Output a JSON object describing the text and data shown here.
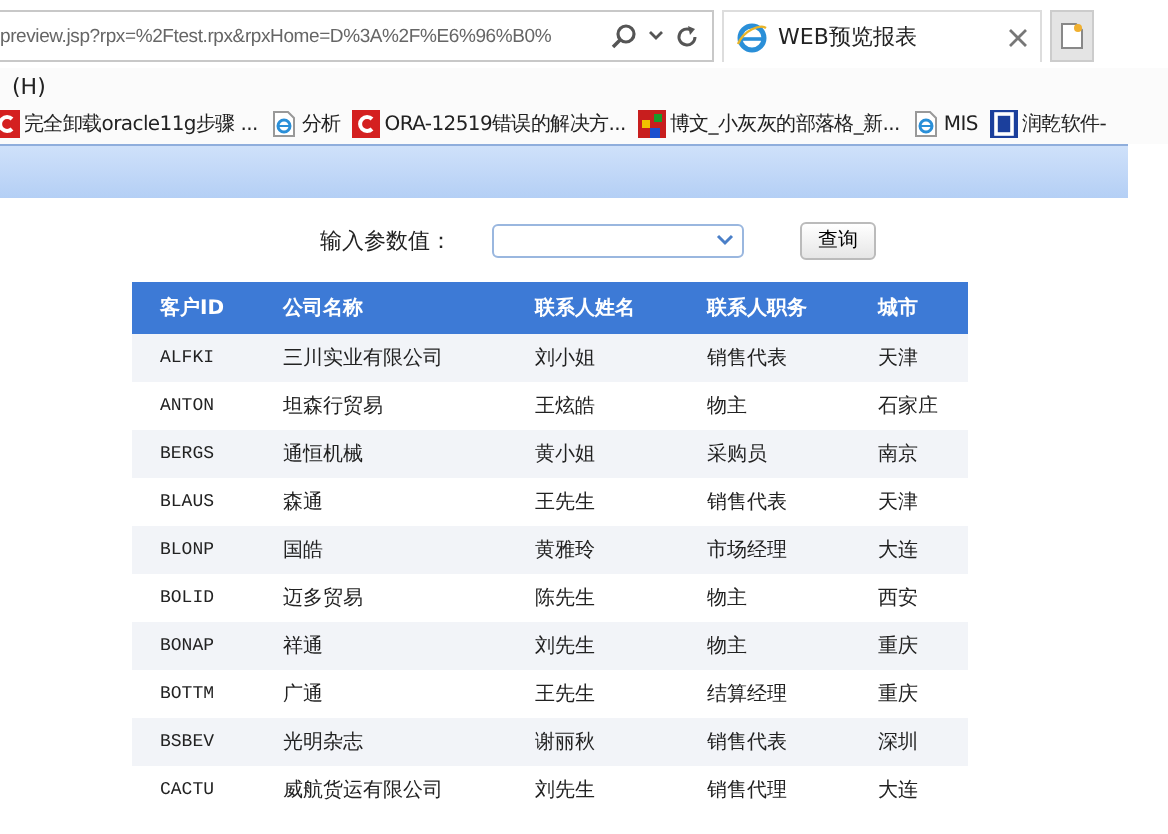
{
  "browser": {
    "address": "preview.jsp?rpx=%2Ftest.rpx&rpxHome=D%3A%2F%E6%96%B0%",
    "tab_title": "WEB预览报表",
    "menu": [
      "(H)"
    ],
    "favorites": [
      {
        "label": "完全卸载oracle11g步骤 ...",
        "kind": "red"
      },
      {
        "label": "分析",
        "kind": "ie"
      },
      {
        "label": "ORA-12519错误的解决方...",
        "kind": "red"
      },
      {
        "label": "博文_小灰灰的部落格_新...",
        "kind": "mosaic"
      },
      {
        "label": "MIS",
        "kind": "ie"
      },
      {
        "label": "润乾软件-",
        "kind": "blue"
      }
    ]
  },
  "form": {
    "label": "输入参数值：",
    "button": "查询"
  },
  "table": {
    "columns": [
      "客户ID",
      "公司名称",
      "联系人姓名",
      "联系人职务",
      "城市"
    ],
    "rows": [
      [
        "ALFKI",
        "三川实业有限公司",
        "刘小姐",
        "销售代表",
        "天津"
      ],
      [
        "ANTON",
        "坦森行贸易",
        "王炫皓",
        "物主",
        "石家庄"
      ],
      [
        "BERGS",
        "通恒机械",
        "黄小姐",
        "采购员",
        "南京"
      ],
      [
        "BLAUS",
        "森通",
        "王先生",
        "销售代表",
        "天津"
      ],
      [
        "BLONP",
        "国皓",
        "黄雅玲",
        "市场经理",
        "大连"
      ],
      [
        "BOLID",
        "迈多贸易",
        "陈先生",
        "物主",
        "西安"
      ],
      [
        "BONAP",
        "祥通",
        "刘先生",
        "物主",
        "重庆"
      ],
      [
        "BOTTM",
        "广通",
        "王先生",
        "结算经理",
        "重庆"
      ],
      [
        "BSBEV",
        "光明杂志",
        "谢丽秋",
        "销售代表",
        "深圳"
      ],
      [
        "CACTU",
        "威航货运有限公司",
        "刘先生",
        "销售代理",
        "大连"
      ]
    ]
  }
}
